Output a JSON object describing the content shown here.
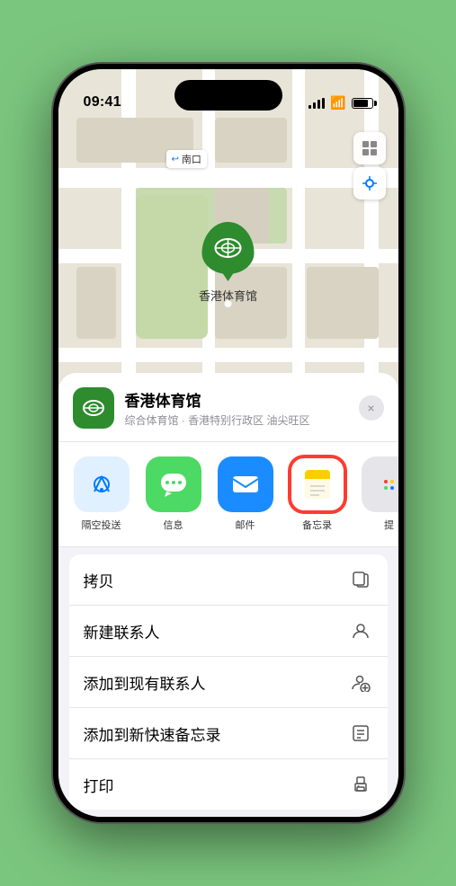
{
  "status_bar": {
    "time": "09:41",
    "location_arrow": "▶"
  },
  "map": {
    "label_tag": "南口",
    "pin_label": "香港体育馆"
  },
  "location_header": {
    "name": "香港体育馆",
    "description": "综合体育馆 · 香港特别行政区 油尖旺区",
    "close_label": "×"
  },
  "share_items": [
    {
      "id": "airdrop",
      "label": "隔空投送"
    },
    {
      "id": "messages",
      "label": "信息"
    },
    {
      "id": "mail",
      "label": "邮件"
    },
    {
      "id": "notes",
      "label": "备忘录"
    },
    {
      "id": "more",
      "label": "提"
    }
  ],
  "action_items": [
    {
      "label": "拷贝",
      "icon": "copy"
    },
    {
      "label": "新建联系人",
      "icon": "person"
    },
    {
      "label": "添加到现有联系人",
      "icon": "person-add"
    },
    {
      "label": "添加到新快速备忘录",
      "icon": "note"
    },
    {
      "label": "打印",
      "icon": "print"
    }
  ]
}
